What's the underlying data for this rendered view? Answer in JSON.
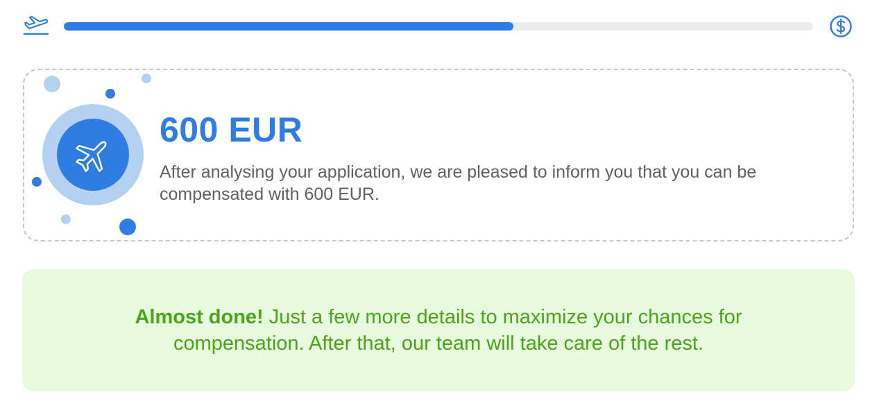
{
  "progress": {
    "percent": 60,
    "start_icon": "takeoff-icon",
    "end_icon": "dollar-circle-icon",
    "track_color": "#e9ebee",
    "fill_color": "#2f7de1"
  },
  "result": {
    "icon": "airplane-icon",
    "amount": "600 EUR",
    "description": "After analysing your application, we are pleased to inform you that you can be compensated with 600 EUR."
  },
  "notice": {
    "bold_text": "Almost done!",
    "text": " Just a few more details to maximize your chances for compensation. After that, our team will take care of the rest.",
    "background_color": "#e8fbe0",
    "text_color": "#4aa517"
  },
  "colors": {
    "accent": "#2f7de1",
    "light_accent": "#b3d2f2",
    "dashed_border": "#c2c9d2"
  }
}
